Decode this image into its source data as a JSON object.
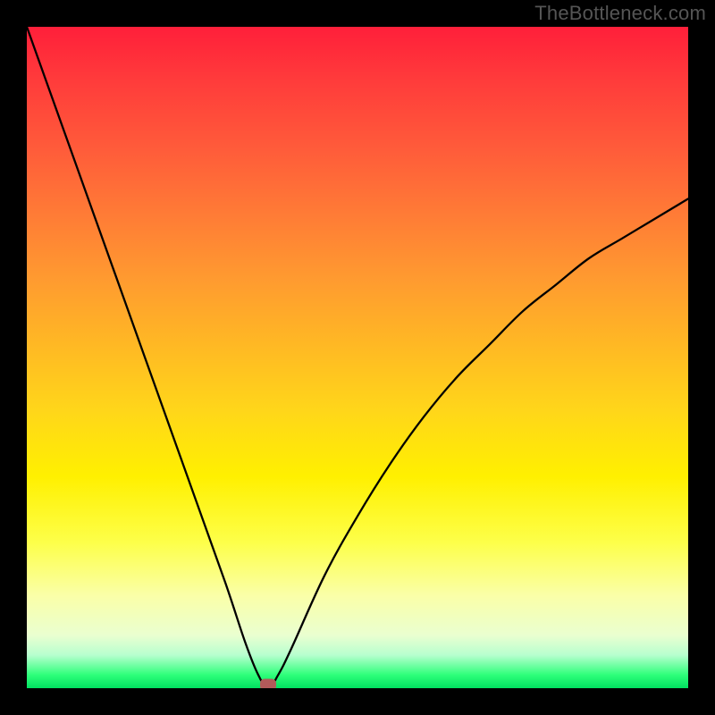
{
  "watermark": "TheBottleneck.com",
  "chart_data": {
    "type": "line",
    "title": "",
    "xlabel": "",
    "ylabel": "",
    "xlim": [
      0,
      100
    ],
    "ylim": [
      0,
      100
    ],
    "grid": false,
    "legend": false,
    "background_gradient": {
      "top_color": "#ff1f3a",
      "mid_color": "#ffe600",
      "bottom_color": "#00e060"
    },
    "series": [
      {
        "name": "bottleneck-curve",
        "color": "#000000",
        "x": [
          0,
          5,
          10,
          15,
          20,
          25,
          30,
          33,
          35,
          36.5,
          38,
          40,
          45,
          50,
          55,
          60,
          65,
          70,
          75,
          80,
          85,
          90,
          95,
          100
        ],
        "values": [
          100,
          86,
          72,
          58,
          44,
          30,
          16,
          7,
          2,
          0,
          2,
          6,
          17,
          26,
          34,
          41,
          47,
          52,
          57,
          61,
          65,
          68,
          71,
          74
        ]
      }
    ],
    "marker": {
      "name": "optimal-point",
      "x": 36.5,
      "y": 0,
      "color": "#b25a5a"
    }
  }
}
